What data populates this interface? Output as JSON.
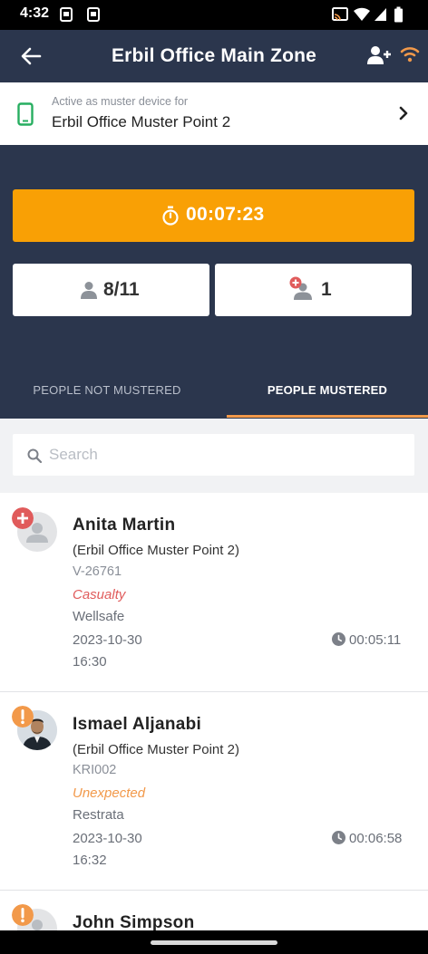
{
  "status_bar": {
    "time": "4:32",
    "icons": [
      "app-notification-icon",
      "app-notification-icon",
      "cast-icon",
      "wifi-icon",
      "signal-icon",
      "battery-icon"
    ]
  },
  "header": {
    "title": "Erbil Office Main Zone",
    "back_icon": "arrow-left-icon",
    "add_user_icon": "add-user-icon",
    "connection_icon": "wifi-icon",
    "connection_color": "#f2994a"
  },
  "device": {
    "subtitle": "Active as muster device for",
    "name": "Erbil Office Muster Point 2",
    "icon": "mobile-phone-icon",
    "icon_color": "#27ae60"
  },
  "muster": {
    "timer": "00:07:23",
    "timer_color": "#f9a005",
    "people_count": "8/11",
    "casualty_count": "1"
  },
  "tabs": [
    {
      "label": "PEOPLE NOT MUSTERED",
      "active": false
    },
    {
      "label": "PEOPLE MUSTERED",
      "active": true
    }
  ],
  "search": {
    "placeholder": "Search",
    "value": ""
  },
  "people": [
    {
      "name": "Anita Martin",
      "zone": "(Erbil Office Muster Point 2)",
      "code": "V-26761",
      "status": "Casualty",
      "status_color": "#e05b5b",
      "company": "Wellsafe",
      "date": "2023-10-30",
      "time": "16:30",
      "elapsed": "00:05:11",
      "badge": "plus-icon",
      "badge_color": "#e05b5b",
      "avatar": "placeholder-avatar"
    },
    {
      "name": "Ismael Aljanabi",
      "zone": "(Erbil Office Muster Point 2)",
      "code": "KRI002",
      "status": "Unexpected",
      "status_color": "#f2994a",
      "company": "Restrata",
      "date": "2023-10-30",
      "time": "16:32",
      "elapsed": "00:06:58",
      "badge": "exclamation-icon",
      "badge_color": "#f2994a",
      "avatar": "photo-avatar"
    },
    {
      "name": "John Simpson",
      "badge": "exclamation-icon",
      "badge_color": "#f2994a",
      "avatar": "placeholder-avatar"
    }
  ]
}
